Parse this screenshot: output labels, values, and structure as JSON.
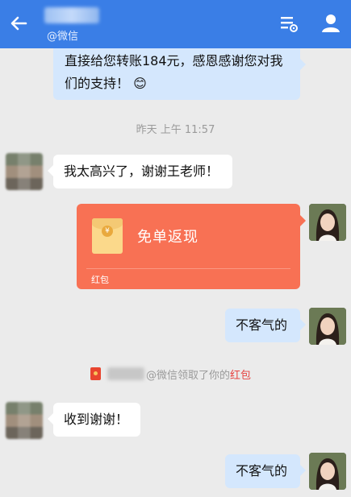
{
  "header": {
    "subtitle": "@微信",
    "back_icon": "back-arrow-icon",
    "settings_icon": "chat-settings-icon",
    "profile_icon": "profile-icon",
    "bar_color": "#3a7ee6"
  },
  "messages": {
    "prev_right_text": "直接给您转账184元，感恩感谢您对我们的支持！",
    "prev_right_emoji": "😊",
    "timestamp": "昨天  上午 11:57",
    "left_1": "我太高兴了，谢谢王老师！",
    "red_packet": {
      "title": "免单返现",
      "footer": "红包",
      "color": "#f87154"
    },
    "right_2": "不客气的",
    "system": {
      "text": "@微信领取了你的",
      "link": "红包",
      "link_color": "#e64340"
    },
    "left_2": "收到谢谢！",
    "right_3": "不客气的"
  }
}
